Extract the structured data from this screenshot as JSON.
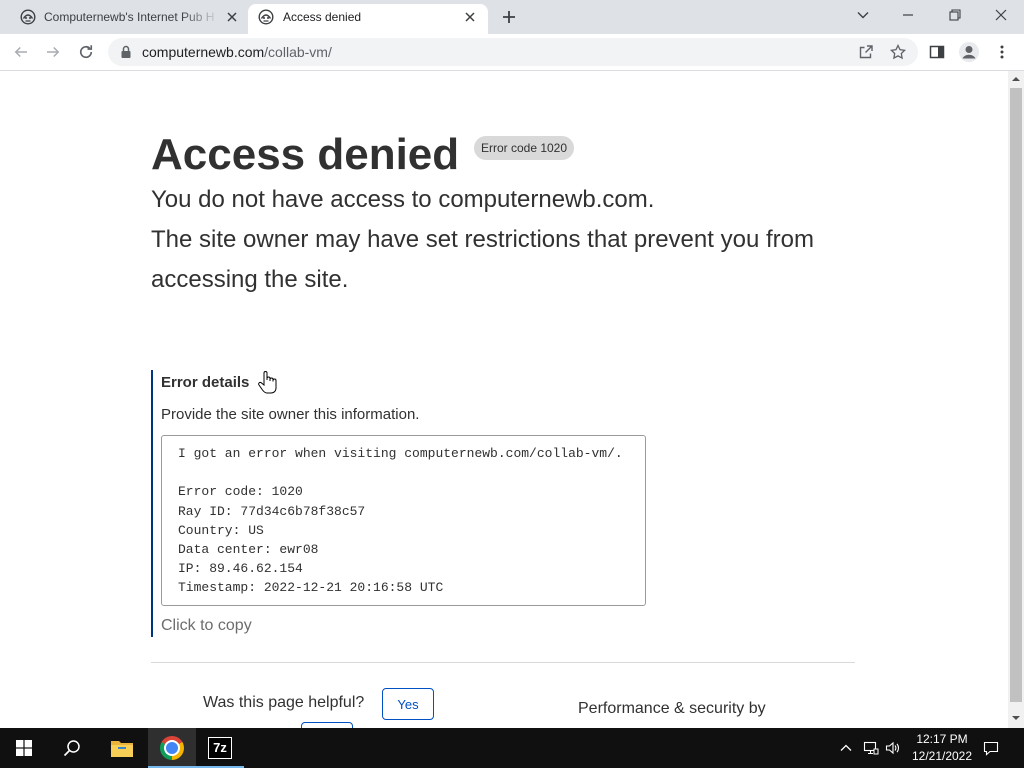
{
  "browser": {
    "tabs": [
      {
        "title": "Computernewb's Internet Pub H",
        "favicon": "computernewb-favicon-icon",
        "active": false
      },
      {
        "title": "Access denied",
        "favicon": "computernewb-favicon-icon",
        "active": true
      }
    ],
    "window_controls": [
      "tab-search-chevron-icon",
      "minimize-icon",
      "restore-icon",
      "close-icon"
    ],
    "toolbar_icons": [
      "back-icon",
      "forward-icon",
      "reload-icon",
      "lock-icon",
      "share-icon",
      "star-icon",
      "side-panel-icon",
      "profile-icon",
      "menu-icon"
    ],
    "address": {
      "host": "computernewb.com",
      "path": "/collab-vm/"
    }
  },
  "page": {
    "title": "Access denied",
    "error_badge": "Error code 1020",
    "message": "You do not have access to computernewb.com.",
    "explanation": "The site owner may have set restrictions that prevent you from accessing the site.",
    "error_details": {
      "heading": "Error details",
      "instructions": "Provide the site owner this information.",
      "report_lines": [
        "I got an error when visiting computernewb.com/collab-vm/.",
        "",
        "Error code: 1020",
        "Ray ID: 77d34c6b78f38c57",
        "Country: US",
        "Data center: ewr08",
        "IP: 89.46.62.154",
        "Timestamp: 2022-12-21 20:16:58 UTC"
      ],
      "copy_label": "Click to copy"
    },
    "feedback": {
      "question": "Was this page helpful?",
      "yes_label": "Yes"
    },
    "footer": {
      "performance_text": "Performance & security by"
    }
  },
  "taskbar": {
    "pinned_apps": [
      {
        "icon": "file-explorer-icon",
        "active": false
      },
      {
        "icon": "chrome-icon",
        "active": true
      },
      {
        "icon": "7zip-icon",
        "logo_text": "7z",
        "active": false
      }
    ],
    "tray_icons": [
      "show-hidden-icons-chevron-icon",
      "network-icon",
      "volume-icon",
      "notifications-icon"
    ],
    "clock": {
      "time": "12:17 PM",
      "date": "12/21/2022"
    }
  },
  "colors": {
    "page_text": "#313131",
    "accent_blue": "#0051c3",
    "details_border": "#003681",
    "badge_background": "#d9d9d9",
    "muted_text": "#6d6d6d"
  }
}
